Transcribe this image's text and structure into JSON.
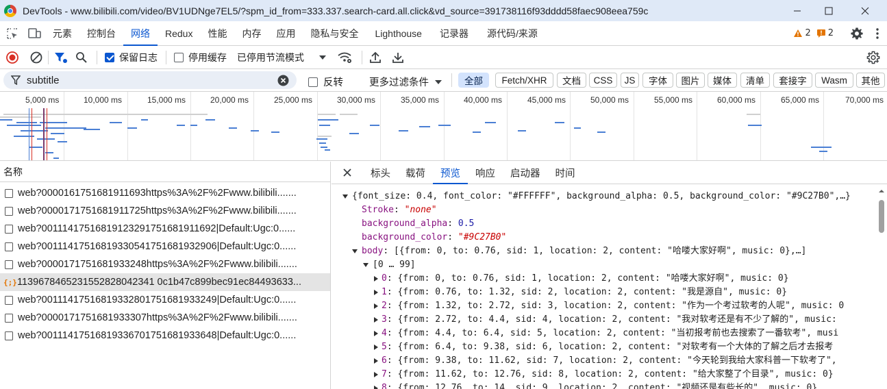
{
  "window": {
    "title": "DevTools - www.bilibili.com/video/BV1UDNge7EL5/?spm_id_from=333.337.search-card.all.click&vd_source=391738116f93dddd58faec908eea759c"
  },
  "panel_tabs": [
    "元素",
    "控制台",
    "网络",
    "Redux",
    "性能",
    "内存",
    "应用",
    "隐私与安全",
    "Lighthouse",
    "记录器",
    "源代码/来源"
  ],
  "active_panel": "网络",
  "issues": {
    "warnings": "2",
    "errors": "2",
    "warning_color": "#e37400",
    "error_color": "#e37400"
  },
  "toolbar": {
    "preserve_log": "保留日志",
    "disable_cache": "停用缓存",
    "throttling": "已停用节流模式"
  },
  "filter": {
    "value": "subtitle",
    "invert": "反转",
    "more_filters": "更多过滤条件",
    "types": [
      "全部",
      "Fetch/XHR",
      "文档",
      "CSS",
      "JS",
      "字体",
      "图片",
      "媒体",
      "清单",
      "套接字",
      "Wasm",
      "其他"
    ],
    "active_type": "全部"
  },
  "overview": {
    "tick_labels": [
      "5,000 ms",
      "10,000 ms",
      "15,000 ms",
      "20,000 ms",
      "25,000 ms",
      "30,000 ms",
      "35,000 ms",
      "40,000 ms",
      "45,000 ms",
      "50,000 ms",
      "55,000 ms",
      "60,000 ms",
      "65,000 ms",
      "70,000 ms"
    ]
  },
  "request_list": {
    "header": "名称",
    "rows": [
      "web?0000161751681911693https%3A%2F%2Fwww.bilibili.......",
      "web?0000171751681911725https%3A%2F%2Fwww.bilibili.......",
      "web?00111417516819123291751681911692|Default:Ugc:0......",
      "web?00111417516819330541751681932906|Default:Ugc:0......",
      "web?0000171751681933248https%3A%2F%2Fwww.bilibili.......",
      "1139678465231552828042341 0c1b47c899bec91ec84493633...",
      "web?00111417516819332801751681933249|Default:Ugc:0......",
      "web?0000171751681933307https%3A%2F%2Fwww.bilibili.......",
      "web?00111417516819336701751681933648|Default:Ugc:0......"
    ],
    "selected_index": 5
  },
  "detail_tabs": [
    "标头",
    "载荷",
    "预览",
    "响应",
    "启动器",
    "时间"
  ],
  "active_detail_tab": "预览",
  "preview": {
    "root_summary": "{font_size: 0.4, font_color: \"#FFFFFF\", background_alpha: 0.5, background_color: \"#9C27B0\",…}",
    "props": [
      {
        "key": "Stroke",
        "sep": ": ",
        "value": "\"none\"",
        "kind": "str"
      },
      {
        "key": "background_alpha",
        "sep": ": ",
        "value": "0.5",
        "kind": "num"
      },
      {
        "key": "background_color",
        "sep": ": ",
        "value": "\"#9C27B0\"",
        "kind": "str"
      }
    ],
    "body_key": "body",
    "body_summary": ": [{from: 0, to: 0.76, sid: 1, location: 2, content: \"哈喽大家好啊\", music: 0},…]",
    "range_label": "[0 … 99]",
    "items": [
      {
        "index": "0",
        "text": ": {from: 0, to: 0.76, sid: 1, location: 2, content: \"哈喽大家好啊\", music: 0}"
      },
      {
        "index": "1",
        "text": ": {from: 0.76, to: 1.32, sid: 2, location: 2, content: \"我是源自\", music: 0}"
      },
      {
        "index": "2",
        "text": ": {from: 1.32, to: 2.72, sid: 3, location: 2, content: \"作为一个考过软考的人呢\", music: 0"
      },
      {
        "index": "3",
        "text": ": {from: 2.72, to: 4.4, sid: 4, location: 2, content: \"我对软考还是有不少了解的\", music:"
      },
      {
        "index": "4",
        "text": ": {from: 4.4, to: 6.4, sid: 5, location: 2, content: \"当初报考前也去搜索了一番软考\", musi"
      },
      {
        "index": "5",
        "text": ": {from: 6.4, to: 9.38, sid: 6, location: 2, content: \"对软考有一个大体的了解之后才去报考"
      },
      {
        "index": "6",
        "text": ": {from: 9.38, to: 11.62, sid: 7, location: 2, content: \"今天轮到我给大家科普一下软考了\","
      },
      {
        "index": "7",
        "text": ": {from: 11.62, to: 12.76, sid: 8, location: 2, content: \"给大家整了个目录\", music: 0}"
      },
      {
        "index": "8",
        "text": ": {from: 12.76, to: 14, sid: 9, location: 2, content: \"视频还是有些长的\", music: 0}"
      }
    ]
  }
}
